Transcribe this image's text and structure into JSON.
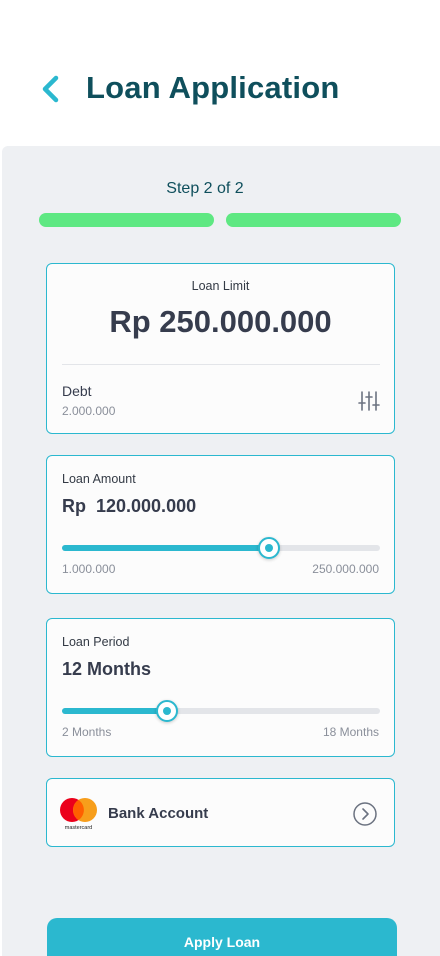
{
  "header": {
    "back_icon": "chevron-left-icon",
    "title": "Loan Application"
  },
  "stepper": {
    "label": "Step 2 of 2",
    "current_step": 2,
    "total_steps": 2,
    "color": "#5ee882"
  },
  "loan_limit": {
    "label": "Loan Limit",
    "value": "Rp 250.000.000",
    "debt_label": "Debt",
    "debt_value": "2.000.000",
    "filter_icon": "sliders-icon"
  },
  "loan_amount": {
    "label": "Loan Amount",
    "value": "Rp  120.000.000",
    "min": "1.000.000",
    "max": "250.000.000",
    "slider_fraction": 0.65
  },
  "loan_period": {
    "label": "Loan Period",
    "value": "12 Months",
    "min": "2 Months",
    "max": "18 Months",
    "slider_fraction": 0.33
  },
  "bank_account": {
    "logo_icon": "mastercard-logo",
    "logo_text": "mastercard",
    "label": "Bank Account",
    "arrow_icon": "chevron-right-circle-icon"
  },
  "apply_button": {
    "label": "Apply Loan"
  },
  "colors": {
    "accent": "#2bb8cf",
    "title": "#0f4f5c",
    "progress": "#5ee882",
    "background": "#eef0f3"
  }
}
